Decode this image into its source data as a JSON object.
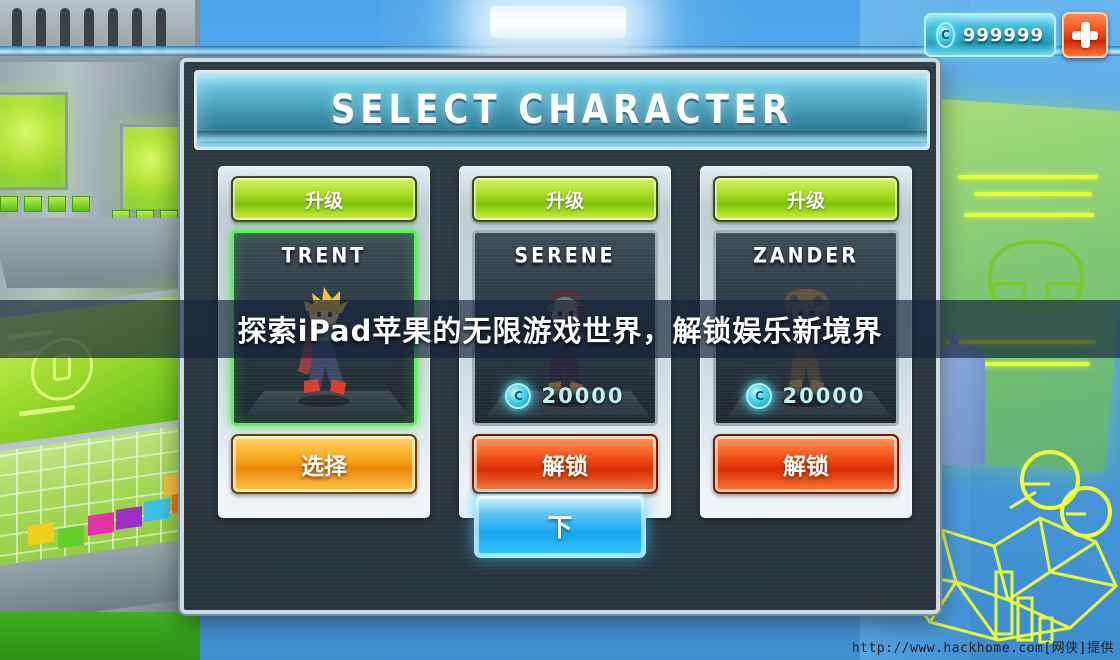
{
  "hud": {
    "coin_icon": "coin-icon",
    "coin_symbol": "C",
    "amount": "999999",
    "plus_icon": "plus-icon"
  },
  "dialog": {
    "title": "SELECT CHARACTER",
    "next_label": "下",
    "cards": [
      {
        "upgrade_label": "升级",
        "name": "TRENT",
        "state": "selected",
        "price": null,
        "action_label": "选择",
        "action_kind": "select"
      },
      {
        "upgrade_label": "升级",
        "name": "SERENE",
        "state": "locked",
        "price": "20000",
        "action_label": "解锁",
        "action_kind": "unlock"
      },
      {
        "upgrade_label": "升级",
        "name": "ZANDER",
        "state": "locked",
        "price": "20000",
        "action_label": "解锁",
        "action_kind": "unlock"
      }
    ]
  },
  "overlay": {
    "headline": "探索iPad苹果的无限游戏世界，解锁娱乐新境界"
  },
  "watermark": {
    "text": "http://www.hackhome.com[网侠]提供"
  },
  "colors": {
    "accent_green": "#a9dd23",
    "accent_orange": "#f7a719",
    "accent_red": "#f04d13",
    "accent_blue": "#17a6ef",
    "accent_teal": "#3fbcd8",
    "panel_dark": "#2b3740"
  }
}
